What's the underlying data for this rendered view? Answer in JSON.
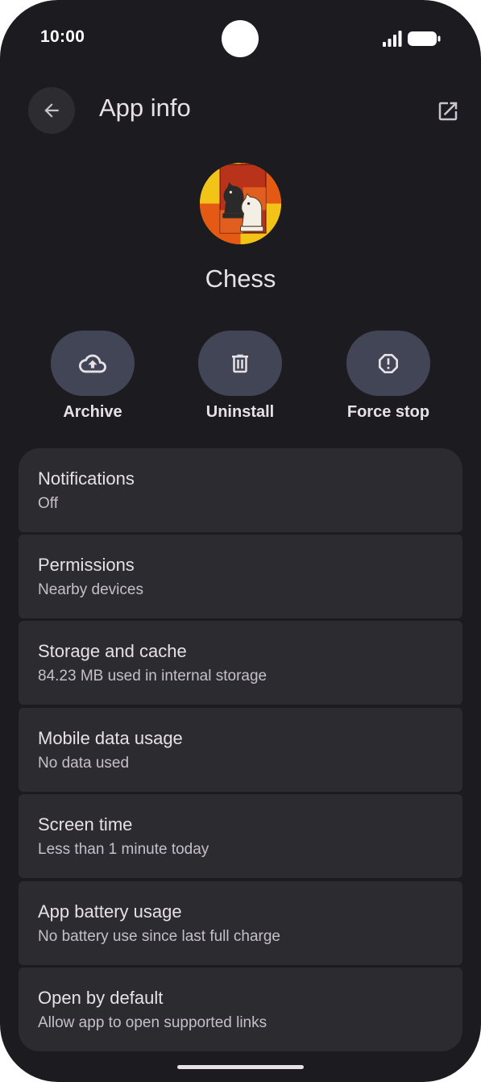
{
  "status_bar": {
    "time": "10:00"
  },
  "header": {
    "title": "App info",
    "back_icon": "arrow-back-icon",
    "open_icon": "open-in-new-icon"
  },
  "app": {
    "name": "Chess",
    "icon": "chess-knight-app-icon"
  },
  "actions": [
    {
      "label": "Archive",
      "icon": "cloud-upload-icon"
    },
    {
      "label": "Uninstall",
      "icon": "trash-icon"
    },
    {
      "label": "Force stop",
      "icon": "stop-octagon-icon"
    }
  ],
  "settings": [
    {
      "title": "Notifications",
      "subtitle": "Off"
    },
    {
      "title": "Permissions",
      "subtitle": "Nearby devices"
    },
    {
      "title": "Storage and cache",
      "subtitle": "84.23 MB used in internal storage"
    },
    {
      "title": "Mobile data usage",
      "subtitle": "No data used"
    },
    {
      "title": "Screen time",
      "subtitle": "Less than 1 minute today"
    },
    {
      "title": "App battery usage",
      "subtitle": "No battery use since last full charge"
    },
    {
      "title": "Open by default",
      "subtitle": "Allow app to open supported links"
    }
  ],
  "colors": {
    "background": "#1c1b1f",
    "card": "#2c2b30",
    "action_button": "#424556",
    "text_primary": "#e6e1e5",
    "text_secondary": "#c4c0c9"
  }
}
